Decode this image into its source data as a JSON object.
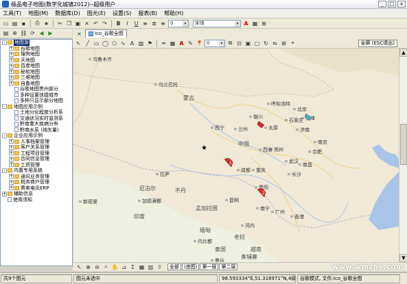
{
  "window": {
    "title": "极品电子地图(数字化城镇2012)--超级用户",
    "minimize": "_",
    "maximize": "□",
    "close": "×"
  },
  "menu": [
    "工具(T)",
    "地图(M)",
    "数据库(D)",
    "图元(E)",
    "设置(S)",
    "报表(B)",
    "帮助(H)"
  ],
  "toolbar": {
    "layer_field": "0",
    "font_field": "宋体",
    "size_field": "0",
    "dropdown_arrow": "▾"
  },
  "map_tab": {
    "label": "Ico_谷歌全图",
    "full_extent_button": "全屏 (ESC退出)"
  },
  "tree": [
    {
      "label": "地图源",
      "level": 0,
      "type": "folder",
      "exp": "-",
      "selected": true
    },
    {
      "label": "谷歌地图",
      "level": 1,
      "type": "folder",
      "exp": "+"
    },
    {
      "label": "搜狗地图",
      "level": 1,
      "type": "folder",
      "exp": "+"
    },
    {
      "label": "天地图",
      "level": 1,
      "type": "folder",
      "exp": "+"
    },
    {
      "label": "百度地图",
      "level": 1,
      "type": "folder",
      "exp": "+"
    },
    {
      "label": "秘软地图",
      "level": 1,
      "type": "folder",
      "exp": "+"
    },
    {
      "label": "三维地图",
      "level": 1,
      "type": "folder",
      "exp": "+"
    },
    {
      "label": "自备地图",
      "level": 1,
      "type": "folder",
      "exp": "+"
    },
    {
      "label": "谷歌地图贵州部分",
      "level": 1,
      "type": "doc"
    },
    {
      "label": "多种设置快捷城市",
      "level": 1,
      "type": "doc"
    },
    {
      "label": "多种只显示部分地图",
      "level": 1,
      "type": "doc"
    },
    {
      "label": "地图应用示例",
      "level": 0,
      "type": "folder",
      "exp": "-"
    },
    {
      "label": "土地分化程度分析系",
      "level": 1,
      "type": "doc"
    },
    {
      "label": "交通状况实时监测系",
      "level": 1,
      "type": "doc"
    },
    {
      "label": "黔南重大疾病分布",
      "level": 1,
      "type": "doc"
    },
    {
      "label": "黔南水系 (纯矢量)",
      "level": 1,
      "type": "doc"
    },
    {
      "label": "企业应用示例",
      "level": 0,
      "type": "folder",
      "exp": "-"
    },
    {
      "label": "人事档案管理",
      "level": 1,
      "type": "folder",
      "exp": "+"
    },
    {
      "label": "客户关系管理",
      "level": 1,
      "type": "folder",
      "exp": "+"
    },
    {
      "label": "工程项目管理",
      "level": 1,
      "type": "folder",
      "exp": "+"
    },
    {
      "label": "合同信息管理",
      "level": 1,
      "type": "folder",
      "exp": "+"
    },
    {
      "label": "工资管理",
      "level": 1,
      "type": "folder",
      "exp": "+"
    },
    {
      "label": "内置专用系统",
      "level": 0,
      "type": "folder",
      "exp": "-"
    },
    {
      "label": "通讯业务管理",
      "level": 1,
      "type": "folder",
      "exp": "+"
    },
    {
      "label": "税务商户管理",
      "level": 1,
      "type": "folder",
      "exp": "+"
    },
    {
      "label": "寄卖电讯ERP",
      "level": 1,
      "type": "folder",
      "exp": "+"
    },
    {
      "label": "辅助信息",
      "level": 0,
      "type": "folder",
      "exp": "+"
    },
    {
      "label": "使用须知",
      "level": 0,
      "type": "doc"
    }
  ],
  "map_labels": [
    {
      "text": "乌兰巴托",
      "kind": "city"
    },
    {
      "text": "蒙古",
      "kind": "country"
    },
    {
      "text": "呼和浩特",
      "kind": "city"
    },
    {
      "text": "北京",
      "kind": "city"
    },
    {
      "text": "天津",
      "kind": "city"
    },
    {
      "text": "石家庄",
      "kind": "city"
    },
    {
      "text": "太原",
      "kind": "city"
    },
    {
      "text": "济南",
      "kind": "city"
    },
    {
      "text": "银川",
      "kind": "city"
    },
    {
      "text": "兰州",
      "kind": "city"
    },
    {
      "text": "西宁",
      "kind": "city"
    },
    {
      "text": "郑州",
      "kind": "city"
    },
    {
      "text": "西安",
      "kind": "city"
    },
    {
      "text": "中国",
      "kind": "country"
    },
    {
      "text": "合肥",
      "kind": "city"
    },
    {
      "text": "南京",
      "kind": "city"
    },
    {
      "text": "武汉",
      "kind": "city"
    },
    {
      "text": "成都",
      "kind": "city"
    },
    {
      "text": "重庆",
      "kind": "city"
    },
    {
      "text": "长沙",
      "kind": "city"
    },
    {
      "text": "南昌",
      "kind": "city"
    },
    {
      "text": "贵阳",
      "kind": "city"
    },
    {
      "text": "昆明",
      "kind": "city"
    },
    {
      "text": "南宁",
      "kind": "city"
    },
    {
      "text": "广州",
      "kind": "city"
    },
    {
      "text": "香港",
      "kind": "city"
    },
    {
      "text": "拉萨",
      "kind": "city"
    },
    {
      "text": "尼泊尔",
      "kind": "country"
    },
    {
      "text": "加德满都",
      "kind": "city"
    },
    {
      "text": "不丹",
      "kind": "country"
    },
    {
      "text": "新德里",
      "kind": "city"
    },
    {
      "text": "印度",
      "kind": "country"
    },
    {
      "text": "孟加拉国",
      "kind": "country"
    },
    {
      "text": "缅甸",
      "kind": "country"
    },
    {
      "text": "内比都",
      "kind": "city"
    },
    {
      "text": "老挝",
      "kind": "country"
    },
    {
      "text": "河内",
      "kind": "city"
    },
    {
      "text": "泰国",
      "kind": "country"
    },
    {
      "text": "曼谷",
      "kind": "city"
    },
    {
      "text": "柬埔寨",
      "kind": "country"
    },
    {
      "text": "越南",
      "kind": "country"
    },
    {
      "text": "乌鲁木齐",
      "kind": "city"
    }
  ],
  "markers": [
    {
      "label": "1",
      "color": "#d22b2b"
    },
    {
      "label": "2",
      "color": "#d22b2b"
    },
    {
      "label": "",
      "color": "#d22b2b"
    },
    {
      "label": "",
      "color": "#35b5c8"
    }
  ],
  "page_tabs": [
    "全部",
    "(底图)",
    "第一层",
    "第二层"
  ],
  "status": {
    "count": "共9个图元",
    "selection": "图元未选中",
    "coords": "98.593334°E,51.318971°N,4级",
    "mode": "谷歌模式, 文件:Ico_谷歌全图"
  },
  "watermark": "www.wmzhe.com",
  "colors": {
    "selected": "#0a246a",
    "land": "#efe9d6",
    "marker_red": "#d22b2b",
    "marker_cyan": "#35b5c8",
    "water": "#a8c5e8"
  }
}
